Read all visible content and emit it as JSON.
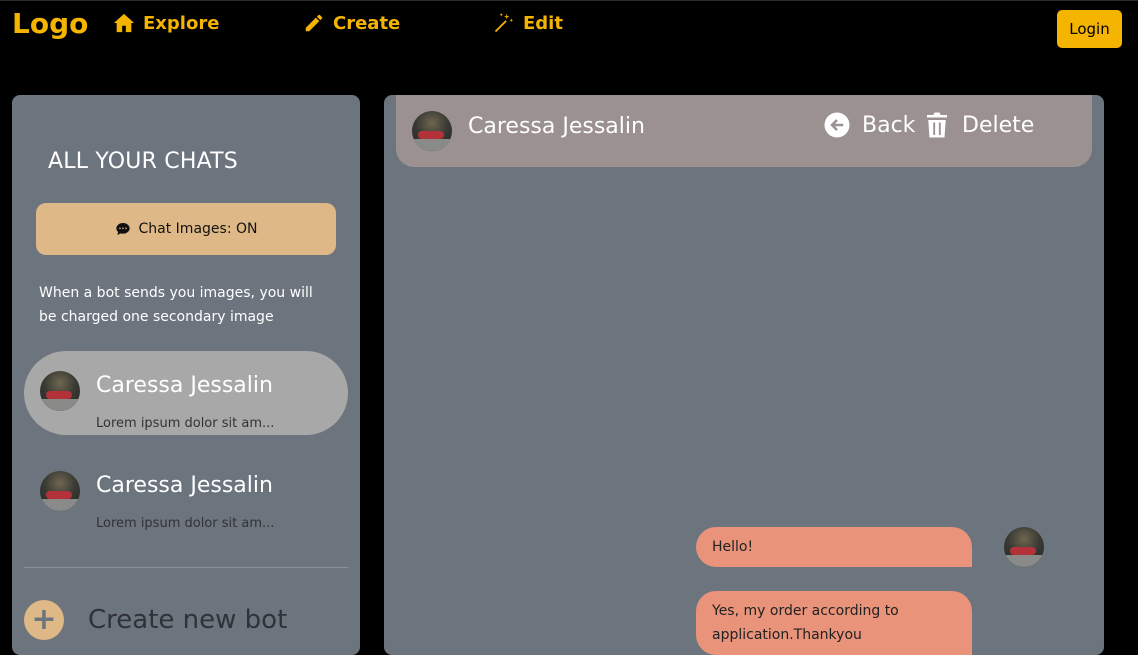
{
  "nav": {
    "logo": "Logo",
    "explore": "Explore",
    "create": "Create",
    "edit": "Edit",
    "login": "Login"
  },
  "sidebar": {
    "title": "ALL YOUR CHATS",
    "toggle_label": "Chat Images: ON",
    "note": "When a bot sends you images, you will be charged one secondary image",
    "chats": [
      {
        "name": "Caressa Jessalin",
        "preview": "Lorem ipsum dolor sit am..."
      },
      {
        "name": "Caressa Jessalin",
        "preview": "Lorem ipsum dolor sit am..."
      }
    ],
    "create_label": "Create new bot",
    "create_icon": "+"
  },
  "chat": {
    "header_name": "Caressa Jessalin",
    "back_label": "Back",
    "delete_label": "Delete",
    "messages": [
      {
        "text": "Hello!"
      },
      {
        "text": "Yes, my order according to application.Thankyou"
      }
    ]
  },
  "colors": {
    "accent": "#f5b400",
    "panel": "#6c747e",
    "toggle": "#dfb887",
    "active_chat": "#a8a8a8",
    "header": "#9a9190",
    "bubble": "#e8937a"
  },
  "icons": {
    "explore": "home-icon",
    "create": "pencil-icon",
    "edit": "magic-wand-icon",
    "toggle": "comment-icon",
    "back": "arrow-left-circle-icon",
    "delete": "trash-icon",
    "create_bot": "plus-icon"
  }
}
